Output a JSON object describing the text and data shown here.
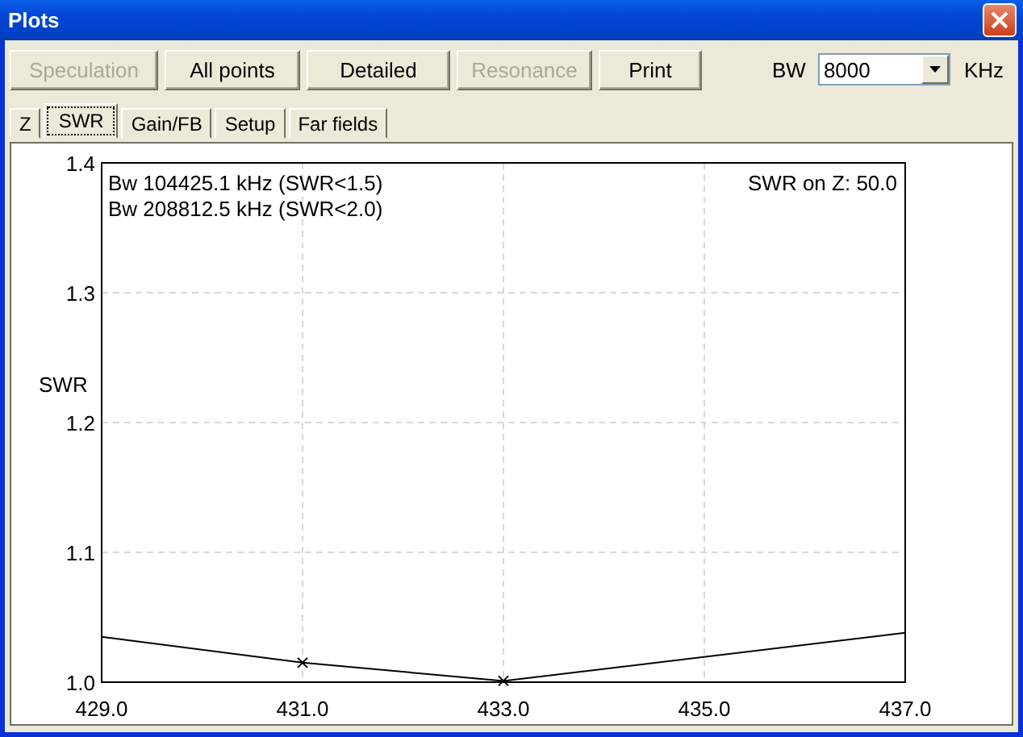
{
  "window": {
    "title": "Plots"
  },
  "buttons": [
    {
      "label": "Speculation",
      "disabled": true
    },
    {
      "label": "All points",
      "disabled": false
    },
    {
      "label": "Detailed",
      "disabled": false
    },
    {
      "label": "Resonance",
      "disabled": true
    },
    {
      "label": "Print",
      "disabled": false
    }
  ],
  "bw": {
    "label": "BW",
    "value": "8000",
    "unit": "KHz"
  },
  "tabs": [
    {
      "label": "Z",
      "selected": false
    },
    {
      "label": "SWR",
      "selected": true
    },
    {
      "label": "Gain/FB",
      "selected": false
    },
    {
      "label": "Setup",
      "selected": false
    },
    {
      "label": "Far fields",
      "selected": false
    }
  ],
  "plot": {
    "notes": [
      "Bw 104425.1 kHz (SWR<1.5)",
      "Bw 208812.5 kHz (SWR<2.0)"
    ],
    "impedance_note": "SWR on Z: 50.0",
    "chart_data": {
      "type": "line",
      "ylabel": "SWR",
      "x": [
        429,
        431,
        433,
        437
      ],
      "grid": true,
      "series": [
        {
          "color": "#000000",
          "values": [
            1.035,
            1.015,
            1.001,
            1.038
          ]
        }
      ],
      "xlim": [
        429,
        437
      ],
      "ylim": [
        1.0,
        1.4
      ],
      "xticks": [
        {
          "value": 429,
          "label": "429.0"
        },
        {
          "value": 431,
          "label": "431.0"
        },
        {
          "value": 433,
          "label": "433.0"
        },
        {
          "value": 435,
          "label": "435.0"
        },
        {
          "value": 437,
          "label": "437.0"
        }
      ],
      "yticks": [
        {
          "value": 1.0,
          "label": "1.0"
        },
        {
          "value": 1.1,
          "label": "1.1"
        },
        {
          "value": 1.2,
          "label": "1.2"
        },
        {
          "value": 1.3,
          "label": "1.3"
        },
        {
          "value": 1.4,
          "label": "1.4"
        }
      ]
    }
  }
}
